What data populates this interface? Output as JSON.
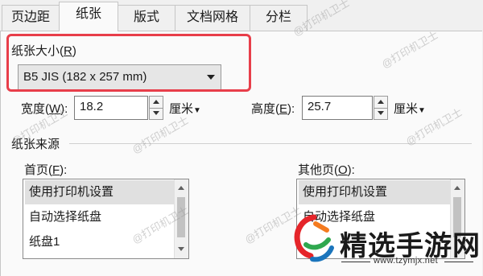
{
  "tabs": [
    {
      "label": "页边距",
      "active": false
    },
    {
      "label": "纸张",
      "active": true
    },
    {
      "label": "版式",
      "active": false
    },
    {
      "label": "文档网格",
      "active": false
    },
    {
      "label": "分栏",
      "active": false
    }
  ],
  "paper_size": {
    "label": "纸张大小(",
    "access_key": "R",
    "label_close": ")",
    "selected": "B5 JIS (182 x 257 mm)"
  },
  "width": {
    "label": "宽度(",
    "access_key": "W",
    "label_close": "):",
    "value": "18.2",
    "unit": "厘米"
  },
  "height": {
    "label": "高度(",
    "access_key": "E",
    "label_close": "):",
    "value": "25.7",
    "unit": "厘米"
  },
  "paper_source": {
    "title": "纸张来源",
    "first_page": {
      "label": "首页(",
      "access_key": "F",
      "label_close": "):",
      "items": [
        "使用打印机设置",
        "自动选择纸盘",
        "纸盘1"
      ]
    },
    "other_pages": {
      "label": "其他页(",
      "access_key": "O",
      "label_close": "):",
      "items": [
        "使用打印机设置",
        "自动选择纸盘"
      ]
    }
  },
  "watermark": "@打印机卫士",
  "brand": {
    "name": "精选手游网",
    "url": "www.tzymjx.net"
  },
  "colors": {
    "highlight": "#e83e4a",
    "brand_orange": "#f47b20",
    "brand_red": "#e5252a",
    "brand_green": "#2fa84f",
    "brand_blue": "#1b75bc"
  }
}
